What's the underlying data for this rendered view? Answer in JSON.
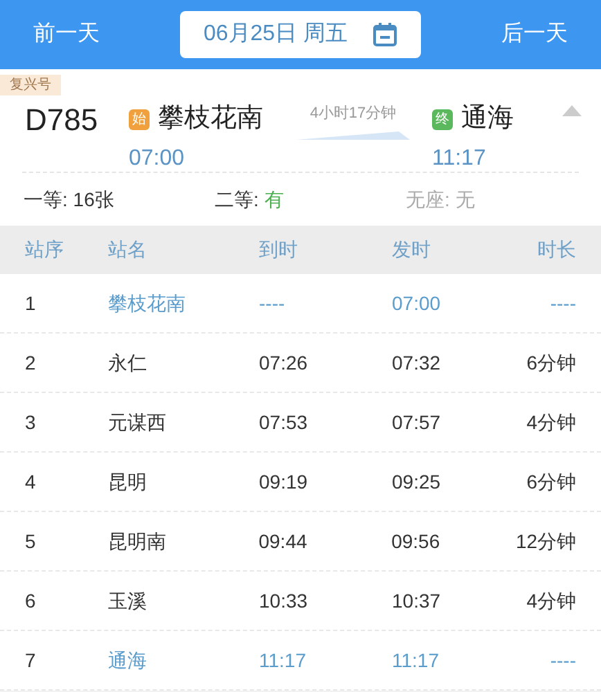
{
  "nav": {
    "prev": "前一天",
    "date": "06月25日 周五",
    "next": "后一天"
  },
  "train": {
    "tag": "复兴号",
    "number": "D785",
    "duration": "4小时17分钟",
    "expanded": true,
    "from": {
      "badge": "始",
      "color": "#f0a03c",
      "station": "攀枝花南",
      "time": "07:00"
    },
    "to": {
      "badge": "终",
      "color": "#5cb85c",
      "station": "通海",
      "time": "11:17"
    }
  },
  "seats": [
    {
      "label": "一等:",
      "value": "16张",
      "kind": "count"
    },
    {
      "label": "二等:",
      "value": "有",
      "kind": "available"
    },
    {
      "label": "无座:",
      "value": "无",
      "kind": "none"
    }
  ],
  "table": {
    "columns": [
      "站序",
      "站名",
      "到时",
      "发时",
      "时长"
    ],
    "rows": [
      {
        "kind": "endpoint",
        "cells": [
          "1",
          "攀枝花南",
          "----",
          "07:00",
          "----"
        ]
      },
      {
        "kind": "stop",
        "cells": [
          "2",
          "永仁",
          "07:26",
          "07:32",
          "6分钟"
        ]
      },
      {
        "kind": "stop",
        "cells": [
          "3",
          "元谋西",
          "07:53",
          "07:57",
          "4分钟"
        ]
      },
      {
        "kind": "stop",
        "cells": [
          "4",
          "昆明",
          "09:19",
          "09:25",
          "6分钟"
        ]
      },
      {
        "kind": "stop",
        "cells": [
          "5",
          "昆明南",
          "09:44",
          "09:56",
          "12分钟"
        ]
      },
      {
        "kind": "stop",
        "cells": [
          "6",
          "玉溪",
          "10:33",
          "10:37",
          "4分钟"
        ]
      },
      {
        "kind": "endpoint",
        "cells": [
          "7",
          "通海",
          "11:17",
          "11:17",
          "----"
        ]
      }
    ]
  }
}
